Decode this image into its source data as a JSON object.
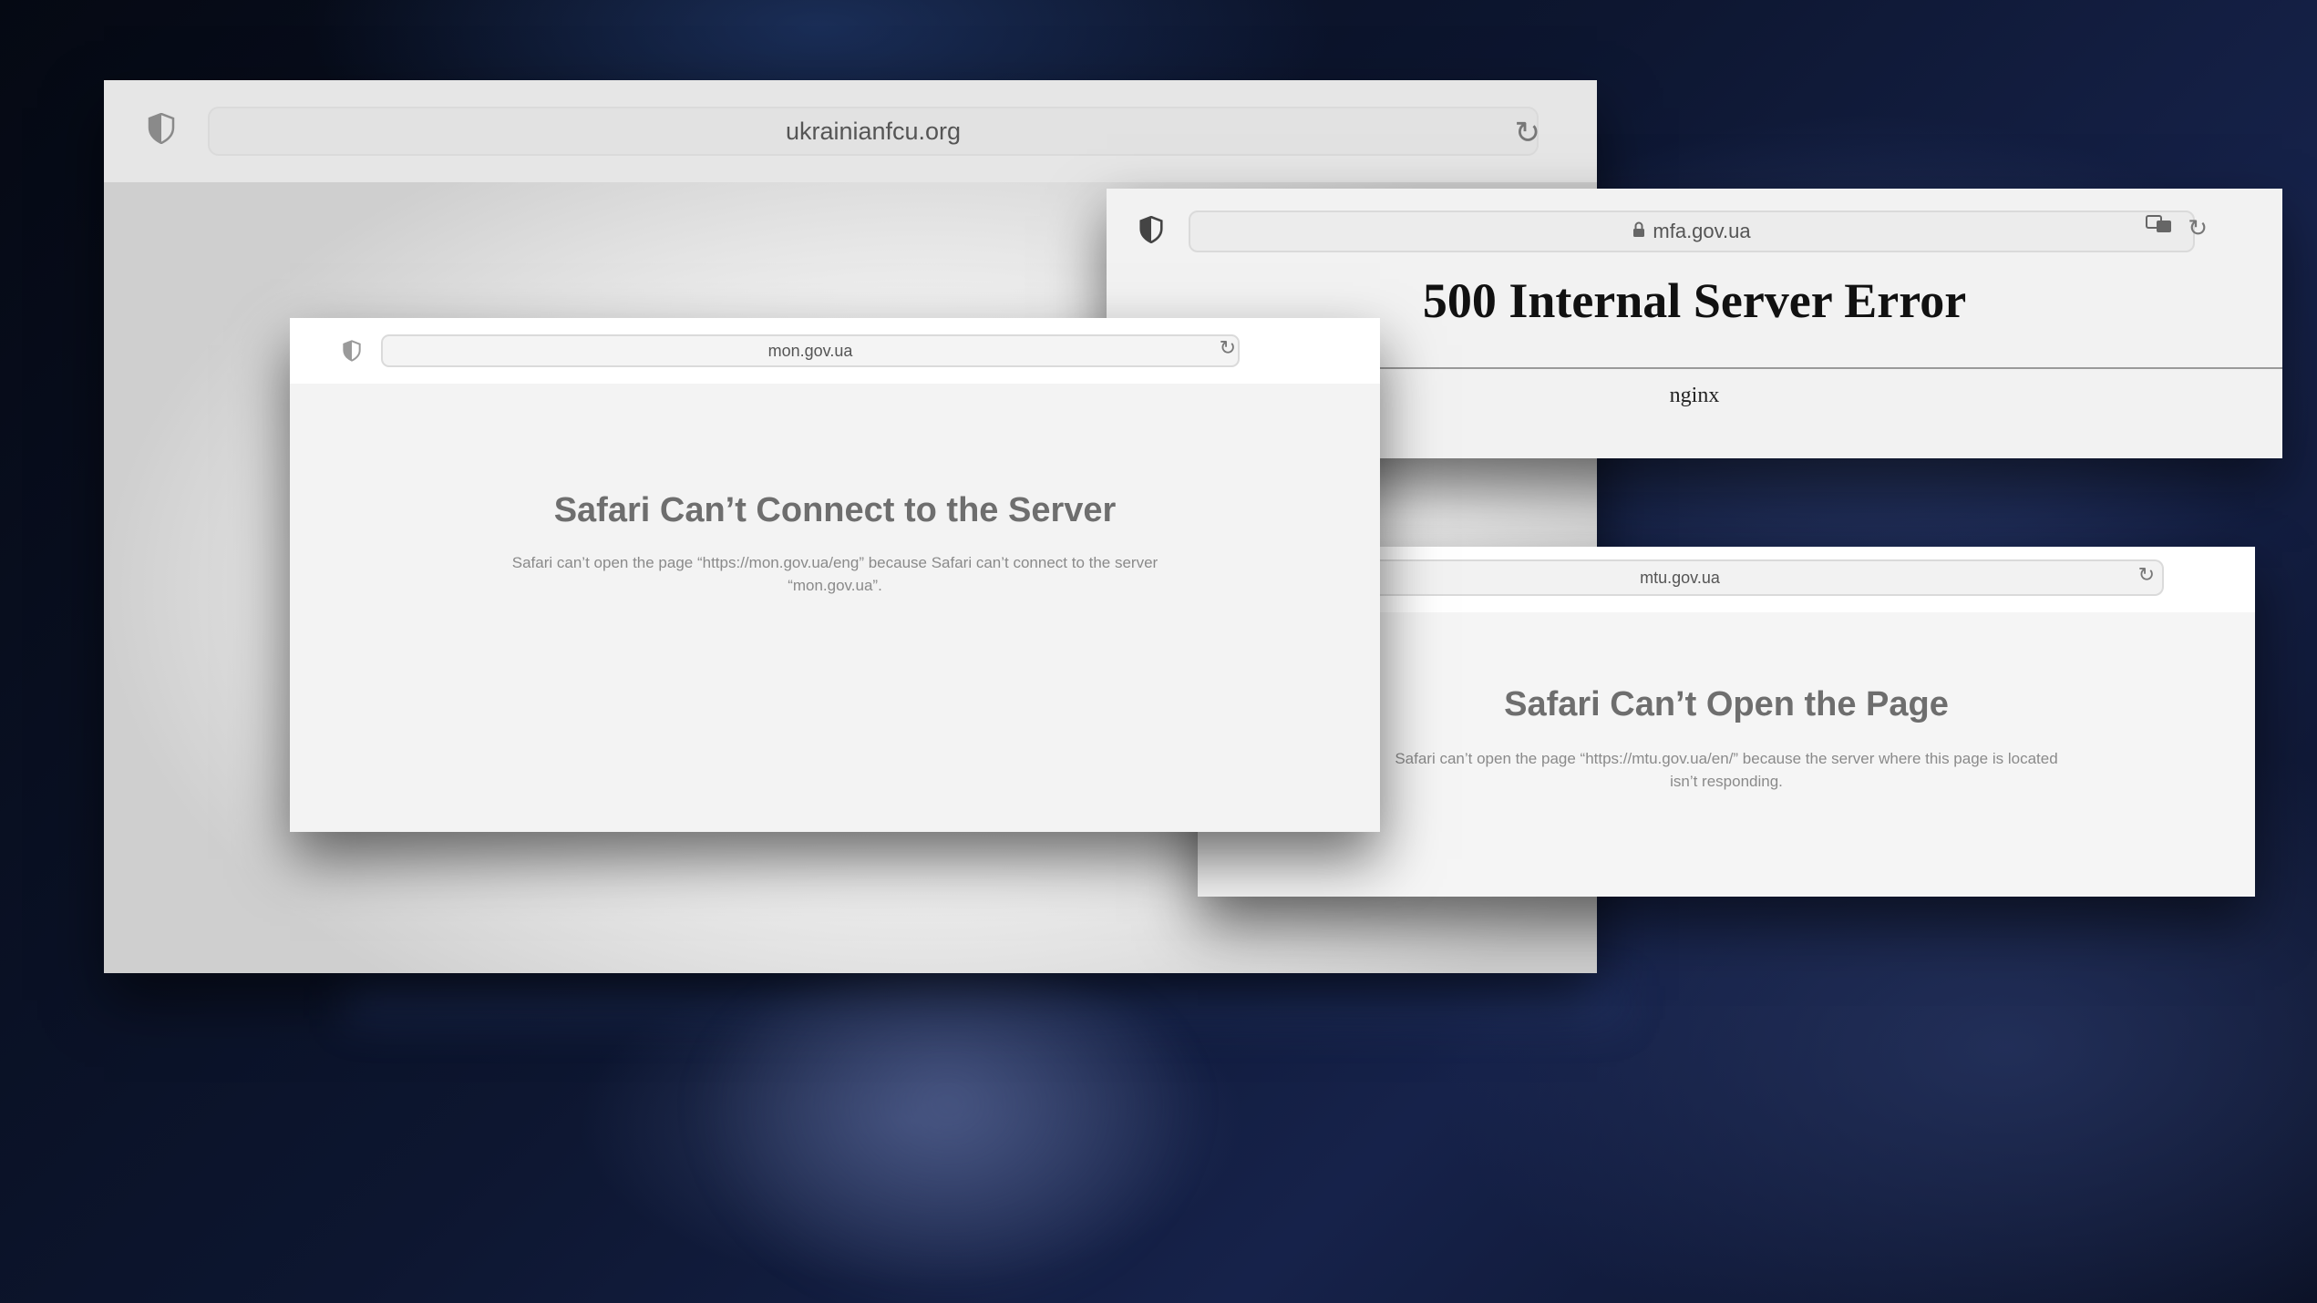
{
  "scene": {
    "background_color": "#0d1630"
  },
  "windows": {
    "back": {
      "url": "ukrainianfcu.org",
      "shield_icon": "shield-icon",
      "reload_icon": "reload-icon"
    },
    "mfa": {
      "url": "mfa.gov.ua",
      "secure_icon": "lock-icon",
      "translate_icon": "translate-icon",
      "error_title": "500 Internal Server Error",
      "server_name": "nginx"
    },
    "mon": {
      "url": "mon.gov.ua",
      "title": "Safari Can’t Connect to the Server",
      "message": "Safari can’t open the page “https://mon.gov.ua/eng” because Safari can’t connect to the server “mon.gov.ua”."
    },
    "mtu": {
      "url": "mtu.gov.ua",
      "title": "Safari Can’t Open the Page",
      "message": "Safari can’t open the page “https://mtu.gov.ua/en/” because the server where this page is located isn’t responding."
    }
  },
  "colors": {
    "error_text": "#6e6e6e",
    "message_text": "#8a8a8a",
    "nginx_title": "#111111"
  }
}
